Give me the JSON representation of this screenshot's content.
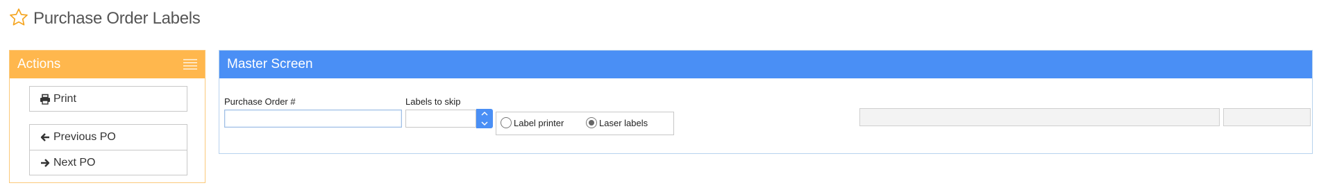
{
  "page": {
    "title": "Purchase Order Labels",
    "favorite_icon": "star-outline-icon"
  },
  "colors": {
    "actions_header": "#ffb74d",
    "master_header": "#4a8ff5",
    "star": "#f5a623"
  },
  "actions": {
    "title": "Actions",
    "menu_icon": "hamburger-menu-icon",
    "buttons": [
      {
        "label": "Print",
        "icon": "print-icon"
      },
      {
        "label": "Previous PO",
        "icon": "arrow-left-icon"
      },
      {
        "label": "Next PO",
        "icon": "arrow-right-icon"
      }
    ]
  },
  "master": {
    "title": "Master Screen",
    "po_label": "Purchase Order #",
    "po_value": "",
    "skip_label": "Labels to skip",
    "skip_value": "",
    "radio_options": [
      {
        "label": "Label printer",
        "checked": false
      },
      {
        "label": "Laser labels",
        "checked": true
      }
    ],
    "readonly_1": "",
    "readonly_2": ""
  }
}
